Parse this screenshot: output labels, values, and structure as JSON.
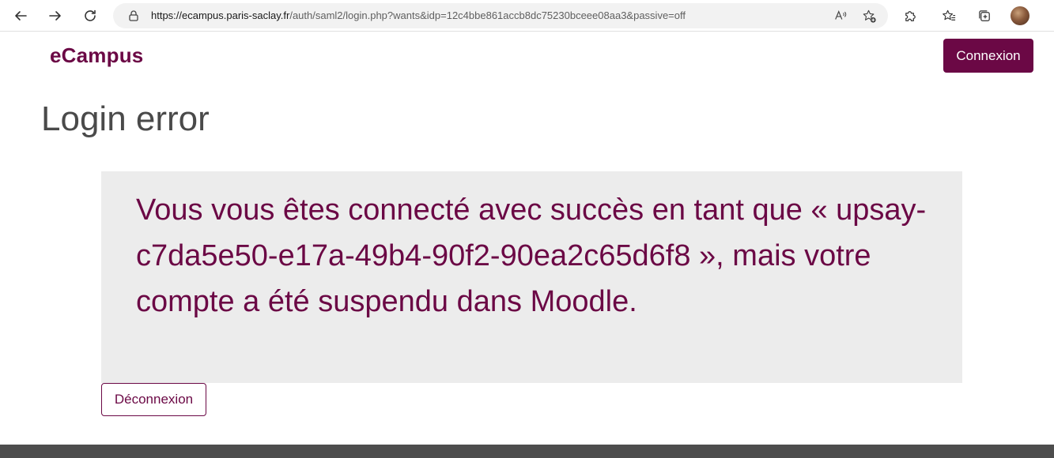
{
  "browser": {
    "url_host": "https://ecampus.paris-saclay.fr",
    "url_path": "/auth/saml2/login.php?wants&idp=12c4bbe861accb8dc75230bceee08aa3&passive=off"
  },
  "header": {
    "brand": "eCampus",
    "login_label": "Connexion"
  },
  "main": {
    "title": "Login error",
    "message": "Vous vous êtes connecté avec succès en tant que « upsay-c7da5e50-e17a-49b4-90f2-90ea2c65d6f8 », mais votre compte a été suspendu dans Moodle.",
    "logout_label": "Déconnexion"
  },
  "colors": {
    "brand": "#6b0845",
    "error_bg": "#ececec",
    "footer": "#4d4d4d"
  }
}
